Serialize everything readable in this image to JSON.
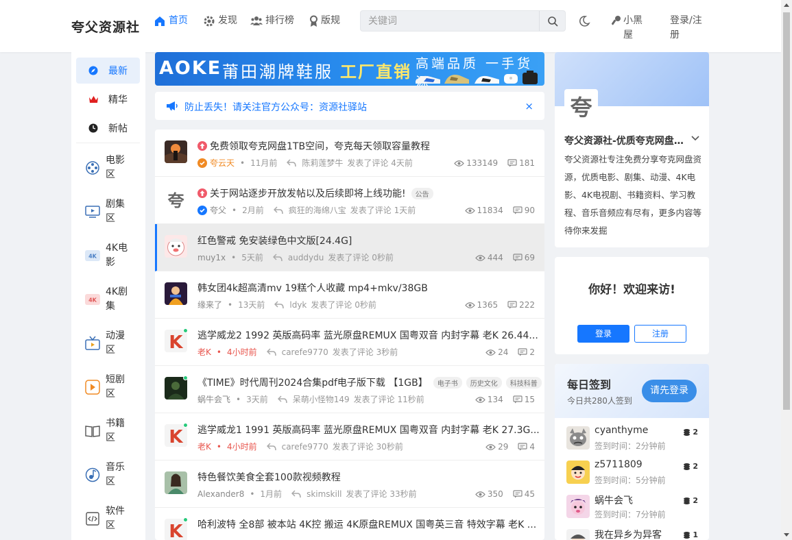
{
  "header": {
    "logo": "夸父资源社",
    "nav": [
      {
        "label": "首页"
      },
      {
        "label": "发现"
      },
      {
        "label": "排行榜"
      },
      {
        "label": "版规"
      }
    ],
    "search_placeholder": "关键词",
    "user_label": "小黑屋",
    "login_label": "登录/注册"
  },
  "sidebar": {
    "top": [
      {
        "label": "最新",
        "icon": "compass-icon"
      },
      {
        "label": "精华",
        "icon": "crown-icon"
      },
      {
        "label": "新帖",
        "icon": "clock-icon"
      }
    ],
    "categories": [
      {
        "label": "电影区",
        "icon": "film-reel-icon"
      },
      {
        "label": "剧集区",
        "icon": "tv-icon"
      },
      {
        "label": "4K电影",
        "icon": "4k-icon"
      },
      {
        "label": "4K剧集",
        "icon": "4k-red-icon"
      },
      {
        "label": "动漫区",
        "icon": "tv-antenna-icon"
      },
      {
        "label": "短剧区",
        "icon": "play-icon"
      },
      {
        "label": "书籍区",
        "icon": "book-icon"
      },
      {
        "label": "音乐区",
        "icon": "music-icon"
      },
      {
        "label": "软件区",
        "icon": "code-icon"
      }
    ]
  },
  "banner": {
    "brand": "AOKE",
    "line1": "莆田潮牌鞋服",
    "line2": "工厂直销",
    "line3": "高端品质 一手货源"
  },
  "notice": {
    "text": "防止丢失！请关注官方公众号：资源社驿站",
    "close": "×"
  },
  "posts": [
    {
      "title": "免费领取夸克网盘1TB空间，夸克每天领取容量教程",
      "pinned": true,
      "tags": [],
      "author": "夸云天",
      "time": "11月前",
      "replier": "陈莉莲梦牛",
      "action": "发表了评论 4天前",
      "views": "133149",
      "comments": "181"
    },
    {
      "title": "关于网站逐步开放发帖以及后续即将上线功能!",
      "pinned": true,
      "tags": [
        "公告"
      ],
      "author": "夸父",
      "time": "2月前",
      "replier": "疯狂的海绵八宝",
      "action": "发表了评论 1天前",
      "views": "11834",
      "comments": "90"
    },
    {
      "title": "红色警戒 免安装绿色中文版[24.4G]",
      "pinned": false,
      "tags": [],
      "author": "muy1x",
      "time": "5天前",
      "replier": "auddydu",
      "action": "发表了评论 0秒前",
      "views": "444",
      "comments": "69"
    },
    {
      "title": "韩女团4k超高清mv 19糕个人收藏 mp4+mkv/38GB",
      "pinned": false,
      "tags": [],
      "author": "缘来了",
      "time": "13天前",
      "replier": "ldyk",
      "action": "发表了评论 0秒前",
      "views": "1365",
      "comments": "222"
    },
    {
      "title": "逃学威龙2 1992 英版高码率 蓝光原盘REMUX 国粤双音 内封字幕 老K 26.44...",
      "pinned": false,
      "tags": [],
      "author": "老K",
      "time": "4小时前",
      "replier": "carefe9770",
      "action": "发表了评论 3秒前",
      "views": "24",
      "comments": "2"
    },
    {
      "title": "《TIME》时代周刊2024合集pdf电子版下载 【1GB】",
      "pinned": false,
      "tags": [
        "电子书",
        "历史文化",
        "科技科普"
      ],
      "author": "蜗牛会飞",
      "time": "3天前",
      "replier": "呆萌小怪物149",
      "action": "发表了评论 11秒前",
      "views": "134",
      "comments": "15"
    },
    {
      "title": "逃学威龙1 1991 英版高码率 蓝光原盘REMUX 国粤双音 内封字幕 老K 27.3G...",
      "pinned": false,
      "tags": [],
      "author": "老K",
      "time": "4小时前",
      "replier": "carefe9770",
      "action": "发表了评论 30秒前",
      "views": "29",
      "comments": "4"
    },
    {
      "title": "特色餐饮美食全套100款视频教程",
      "pinned": false,
      "tags": [],
      "author": "Alexander8",
      "time": "1月前",
      "replier": "skimskill",
      "action": "发表了评论 33秒前",
      "views": "350",
      "comments": "45"
    },
    {
      "title": "哈利波特 全8部 被本站 4K控 搬运 4K原盘REMUX 国粤英三音 特效字幕 老K ...",
      "pinned": false,
      "tags": [],
      "author": "",
      "time": "",
      "replier": "",
      "action": "",
      "views": "",
      "comments": ""
    }
  ],
  "site_info": {
    "avatar_char": "夸",
    "name": "夸父资源社-优质夸克网盘资源分享社区",
    "desc": "夸父资源社专注免费分享夸克网盘资源，优质电影、剧集、动漫、4K电影、4K电视剧、书籍资料、学习教程、音乐音频应有尽有，更多内容等待你来发掘"
  },
  "welcome": {
    "greeting": "你好！欢迎来访!",
    "login": "登录",
    "register": "注册"
  },
  "checkin": {
    "title": "每日签到",
    "subtitle": "今日共280人签到",
    "button": "请先登录",
    "users": [
      {
        "name": "cyanthyme",
        "time": "签到时间：2分钟前",
        "count": "2"
      },
      {
        "name": "z5711809",
        "time": "签到时间：5分钟前",
        "count": "2"
      },
      {
        "name": "蜗牛会飞",
        "time": "签到时间：7分钟前",
        "count": "2"
      },
      {
        "name": "我在异乡为异客",
        "time": "",
        "count": "1"
      }
    ]
  },
  "colors": {
    "accent": "#1677ff",
    "hot": "#e8544c",
    "online": "#27c97b"
  }
}
